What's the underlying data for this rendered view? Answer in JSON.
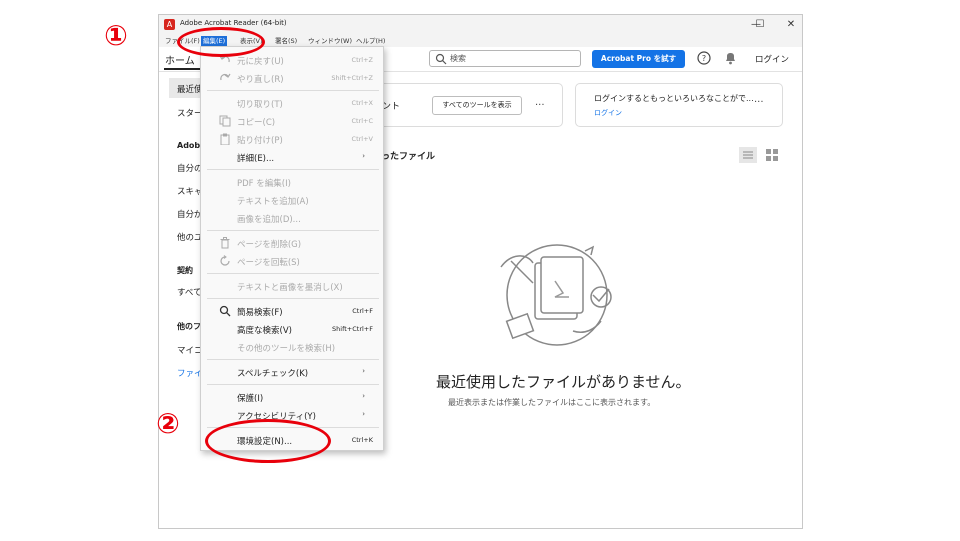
{
  "window": {
    "title": "Adobe Acrobat Reader (64-bit)",
    "min_glyph": "—",
    "max_glyph": "☐",
    "close_glyph": "✕",
    "app_glyph": "A"
  },
  "menubar": {
    "file": "ファイル(F)",
    "edit": "編集(E)",
    "view": "表示(V)",
    "sign": "署名(S)",
    "window": "ウィンドウ(W)",
    "help": "ヘルプ(H)"
  },
  "toolbar": {
    "home": "ホーム",
    "search_placeholder": "検索",
    "pro_button": "Acrobat Pro を試す",
    "login": "ログイン"
  },
  "sidebar": {
    "items": [
      "最近使",
      "スター",
      "自分の",
      "スキャ",
      "自分が",
      "他のユ",
      "すべて",
      "マイコ"
    ],
    "headings": [
      "Adobe",
      "契約",
      "他のフ"
    ],
    "link": "ファイ"
  },
  "cards": {
    "tools_suffix": "ント",
    "all_tools_button": "すべてのツールを表示",
    "login_prompt": "ログインするともっといろいろなことがで...",
    "login_link": "ログイン",
    "more": "..."
  },
  "recent_header_suffix": "ったファイル",
  "empty_state": {
    "title": "最近使用したファイルがありません。",
    "subtitle": "最近表示または作業したファイルはここに表示されます。"
  },
  "edit_menu": {
    "items": [
      {
        "label": "元に戻す(U)",
        "shortcut": "Ctrl+Z",
        "enabled": false,
        "icon": "undo-icon"
      },
      {
        "label": "やり直し(R)",
        "shortcut": "Shift+Ctrl+Z",
        "enabled": false,
        "icon": "redo-icon"
      },
      {
        "label": "切り取り(T)",
        "shortcut": "Ctrl+X",
        "enabled": false,
        "icon": ""
      },
      {
        "label": "コピー(C)",
        "shortcut": "Ctrl+C",
        "enabled": false,
        "icon": "copy-icon"
      },
      {
        "label": "貼り付け(P)",
        "shortcut": "Ctrl+V",
        "enabled": false,
        "icon": "paste-icon"
      },
      {
        "label": "詳細(E)...",
        "shortcut": "",
        "enabled": true,
        "icon": "",
        "submenu": true
      },
      {
        "label": "PDF を編集(I)",
        "shortcut": "",
        "enabled": false,
        "icon": ""
      },
      {
        "label": "テキストを追加(A)",
        "shortcut": "",
        "enabled": false,
        "icon": ""
      },
      {
        "label": "画像を追加(D)...",
        "shortcut": "",
        "enabled": false,
        "icon": ""
      },
      {
        "label": "ページを削除(G)",
        "shortcut": "",
        "enabled": false,
        "icon": "trash-icon"
      },
      {
        "label": "ページを回転(S)",
        "shortcut": "",
        "enabled": false,
        "icon": "rotate-icon"
      },
      {
        "label": "テキストと画像を墨消し(X)",
        "shortcut": "",
        "enabled": false,
        "icon": ""
      },
      {
        "label": "簡易検索(F)",
        "shortcut": "Ctrl+F",
        "enabled": true,
        "icon": "search-icon"
      },
      {
        "label": "高度な検索(V)",
        "shortcut": "Shift+Ctrl+F",
        "enabled": true,
        "icon": ""
      },
      {
        "label": "その他のツールを検索(H)",
        "shortcut": "",
        "enabled": false,
        "icon": ""
      },
      {
        "label": "スペルチェック(K)",
        "shortcut": "",
        "enabled": true,
        "icon": "",
        "submenu": true
      },
      {
        "label": "保護(I)",
        "shortcut": "",
        "enabled": true,
        "icon": "",
        "submenu": true
      },
      {
        "label": "アクセシビリティ(Y)",
        "shortcut": "",
        "enabled": true,
        "icon": "",
        "submenu": true
      },
      {
        "label": "環境設定(N)...",
        "shortcut": "Ctrl+K",
        "enabled": true,
        "icon": ""
      }
    ],
    "submenu_arrow": "›"
  },
  "annotations": {
    "step1": "①",
    "step2": "②",
    "color": "#e8000b"
  },
  "colors": {
    "accent": "#1473e6",
    "menu_active": "#1e6fd9",
    "acrobat_red": "#d7261e"
  }
}
